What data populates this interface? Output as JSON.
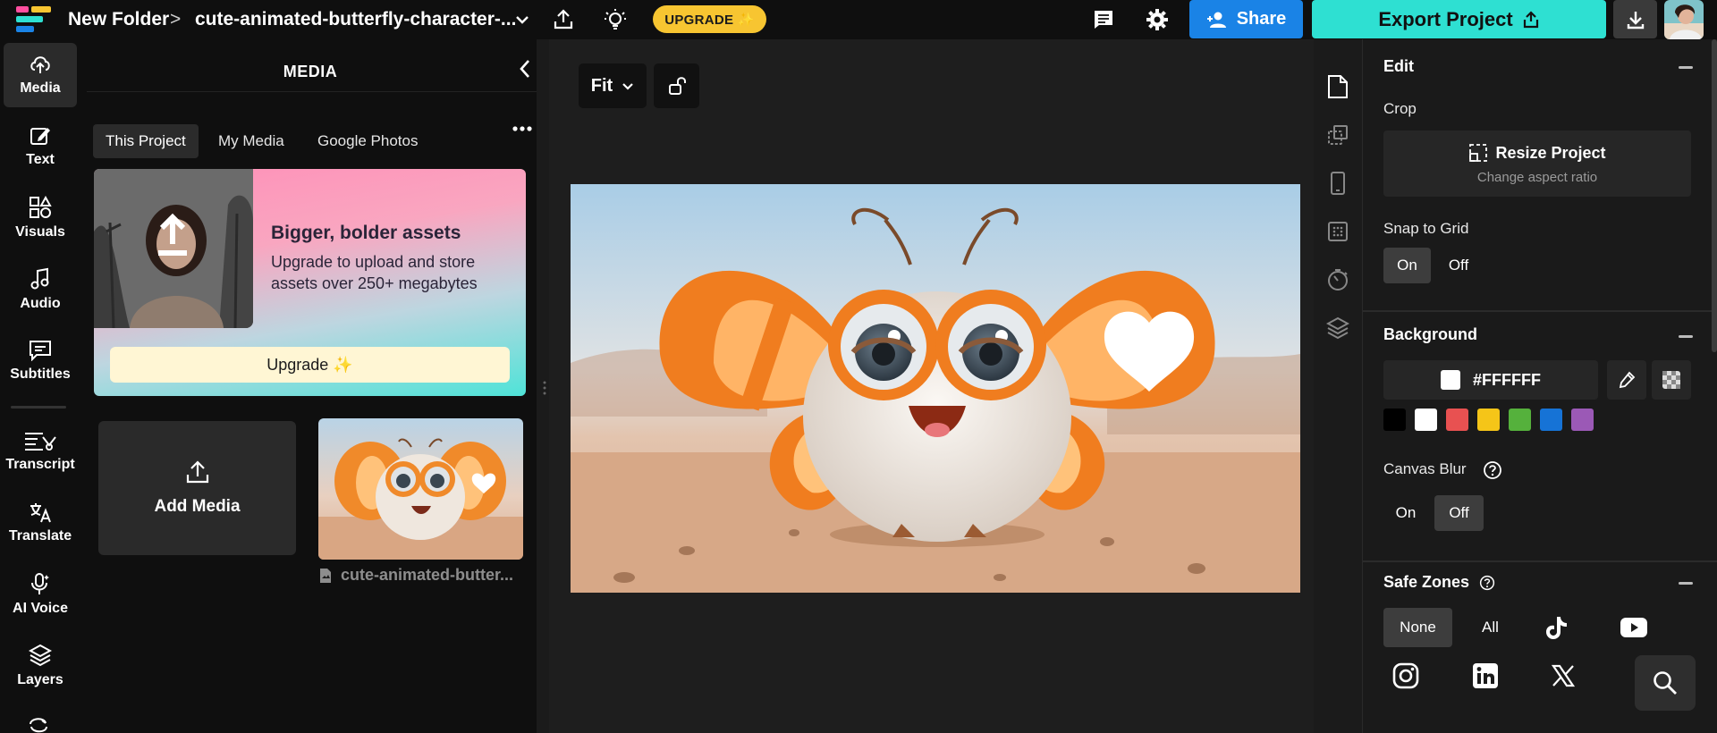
{
  "topbar": {
    "logo_icon": "app-logo",
    "folder": "New Folder",
    "separator": ">",
    "project_name": "cute-animated-butterfly-character-...",
    "upgrade_label": "UPGRADE ✨",
    "share_label": "Share",
    "export_label": "Export Project",
    "icons": [
      "chevron-down-icon",
      "upload-icon",
      "lightbulb-icon",
      "comment-icon",
      "gear-icon",
      "download-icon"
    ]
  },
  "leftnav": {
    "items": [
      {
        "label": "Media",
        "icon": "cloud-upload-icon",
        "active": true
      },
      {
        "label": "Text",
        "icon": "text-edit-icon"
      },
      {
        "label": "Visuals",
        "icon": "shapes-icon"
      },
      {
        "label": "Audio",
        "icon": "music-note-icon"
      },
      {
        "label": "Subtitles",
        "icon": "subtitles-icon"
      },
      {
        "label": "Transcript",
        "icon": "transcript-icon"
      },
      {
        "label": "Translate",
        "icon": "translate-icon"
      },
      {
        "label": "AI Voice",
        "icon": "ai-voice-icon"
      },
      {
        "label": "Layers",
        "icon": "layers-icon"
      }
    ]
  },
  "media_panel": {
    "title": "MEDIA",
    "tabs": [
      "This Project",
      "My Media",
      "Google Photos"
    ],
    "active_tab": "This Project",
    "promo": {
      "title": "Bigger, bolder assets",
      "text": "Upgrade to upload and store assets over 250+ megabytes",
      "button": "Upgrade ✨"
    },
    "add_media_label": "Add Media",
    "asset": {
      "name": "cute-animated-butter..."
    }
  },
  "stage": {
    "zoom_label": "Fit"
  },
  "properties": {
    "edit": {
      "title": "Edit",
      "crop_label": "Crop",
      "resize_title": "Resize Project",
      "resize_subtitle": "Change aspect ratio",
      "snap_label": "Snap to Grid",
      "snap_on": "On",
      "snap_off": "Off",
      "snap_value": "On"
    },
    "background": {
      "title": "Background",
      "hex": "#FFFFFF",
      "swatches": [
        "#000000",
        "#ffffff",
        "#e85151",
        "#f5c518",
        "#55b13c",
        "#1673d6",
        "#9b59b6"
      ],
      "blur_label": "Canvas Blur",
      "blur_on": "On",
      "blur_off": "Off",
      "blur_value": "Off"
    },
    "safe_zones": {
      "title": "Safe Zones",
      "none_label": "None",
      "all_label": "All",
      "selected": "None",
      "platforms": [
        "tiktok-icon",
        "youtube-icon",
        "instagram-icon",
        "linkedin-icon",
        "x-icon"
      ]
    }
  },
  "colors": {
    "accent_share": "#1a83e6",
    "accent_export": "#2ee0d2",
    "upgrade_pill": "#f7c531"
  }
}
